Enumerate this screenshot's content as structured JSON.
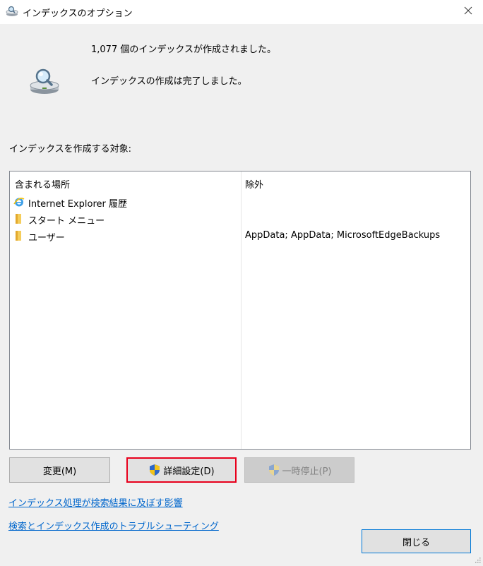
{
  "window": {
    "title": "インデックスのオプション",
    "icons": {
      "app": "indexing-options-icon",
      "close": "close-icon"
    }
  },
  "status": {
    "items_indexed": "1,077 個のインデックスが作成されました。",
    "state": "インデックスの作成は完了しました。",
    "icon": "magnifier-on-drive-icon"
  },
  "locations": {
    "section_label": "インデックスを作成する対象:",
    "columns": {
      "included": "含まれる場所",
      "excluded": "除外"
    },
    "rows": [
      {
        "label": "Internet Explorer 履歴",
        "exclusions": "",
        "icon": "internet-explorer-icon"
      },
      {
        "label": "スタート メニュー",
        "exclusions": "",
        "icon": "folder-icon"
      },
      {
        "label": "ユーザー",
        "exclusions": "AppData; AppData; MicrosoftEdgeBackups",
        "icon": "folder-icon"
      }
    ]
  },
  "buttons": {
    "modify": "変更(M)",
    "advanced": "詳細設定(D)",
    "pause": "一時停止(P)",
    "close": "閉じる"
  },
  "links": {
    "affect_results": "インデックス処理が検索結果に及ぼす影響",
    "troubleshoot": "検索とインデックス作成のトラブルシューティング"
  },
  "colors": {
    "link": "#0066cc",
    "highlight_border": "#e8001c",
    "default_button_border": "#0078d7",
    "dialog_background": "#f0f0f0"
  }
}
